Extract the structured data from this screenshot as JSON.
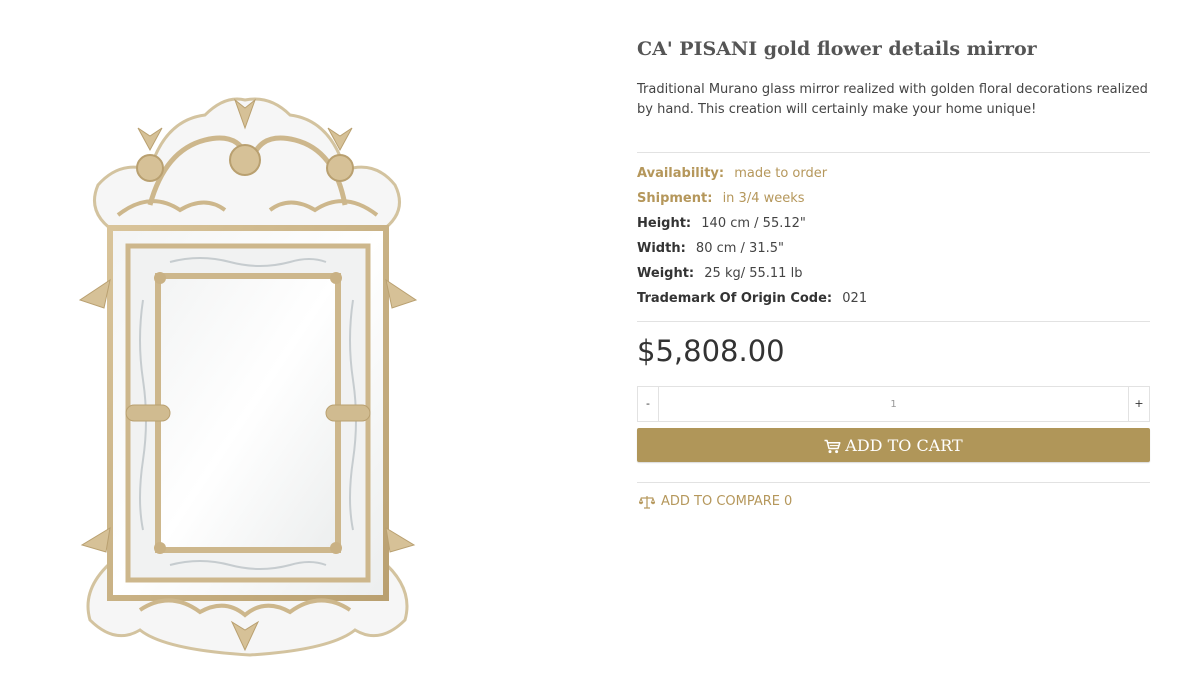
{
  "product": {
    "title": "CA' PISANI gold flower details mirror",
    "description": "Traditional Murano glass mirror realized with golden floral decorations realized by hand. This creation will certainly make your home unique!",
    "image_icon": "murano-mirror-image",
    "attributes": [
      {
        "label": "Availability:",
        "value": "made to order"
      },
      {
        "label": "Shipment:",
        "value": "in 3/4 weeks"
      },
      {
        "label": "Height:",
        "value": "140 cm / 55.12\""
      },
      {
        "label": "Width:",
        "value": "80 cm / 31.5\""
      },
      {
        "label": "Weight:",
        "value": "25 kg/ 55.11 lb"
      },
      {
        "label": "Trademark Of Origin Code:",
        "value": "021"
      }
    ],
    "price": "$5,808.00"
  },
  "quantity": {
    "minus_label": "-",
    "value": "1",
    "plus_label": "+"
  },
  "cart": {
    "label": "ADD TO CART",
    "icon": "cart-icon"
  },
  "compare": {
    "label": "ADD TO COMPARE",
    "count": "0",
    "icon": "scale-icon"
  },
  "colors": {
    "accent": "#b09659",
    "gold_text": "#b5975b",
    "divider": "#e2e2e2"
  }
}
